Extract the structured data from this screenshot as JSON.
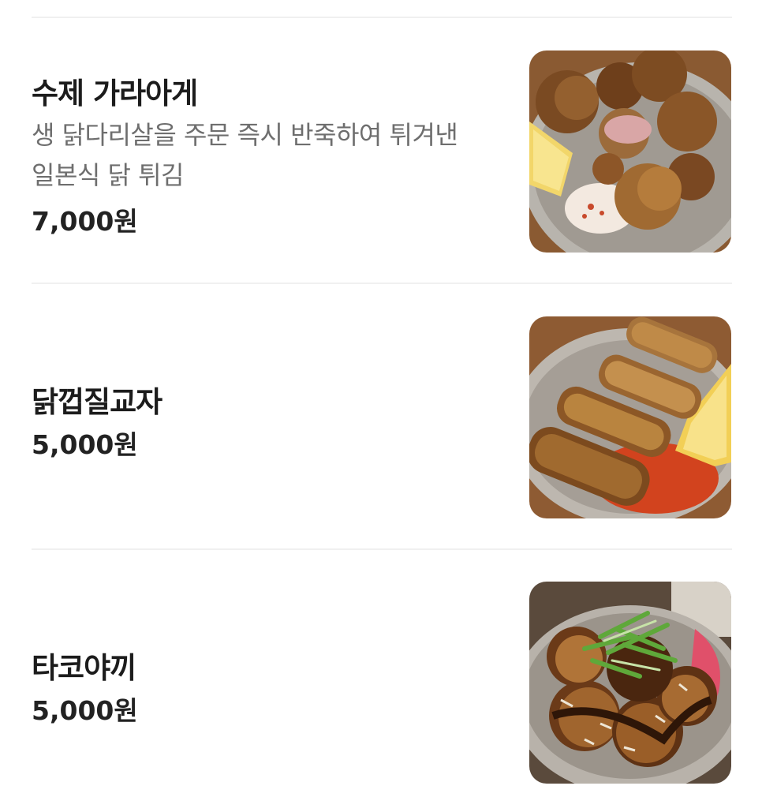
{
  "menu": {
    "items": [
      {
        "name": "수제 가라아게",
        "description_lines": [
          "생 닭다리살을 주문 즉시 반죽하여 튀겨낸",
          "일본식 닭 튀김"
        ],
        "price": "7,000원",
        "image": "karaage-photo"
      },
      {
        "name": "닭껍질교자",
        "price": "5,000원",
        "image": "chicken-skin-gyoza-photo"
      },
      {
        "name": "타코야끼",
        "price": "5,000원",
        "image": "takoyaki-photo"
      }
    ]
  }
}
